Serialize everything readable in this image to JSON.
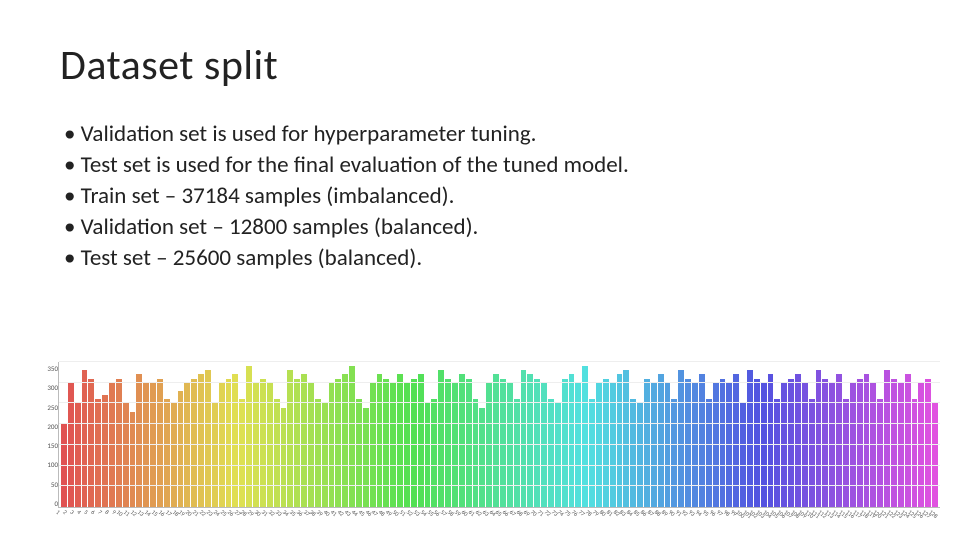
{
  "title": "Dataset split",
  "bullets": [
    "Validation set is used for hyperparameter tuning.",
    "Test set is used for the final evaluation of the tuned model.",
    "Train set – 37184 samples (imbalanced).",
    "Validation set – 12800 samples (balanced).",
    "Test set – 25600 samples (balanced)."
  ],
  "chart_data": {
    "type": "bar",
    "title": "",
    "xlabel": "",
    "ylabel": "",
    "ylim": [
      0,
      350
    ],
    "y_ticks": [
      0,
      50,
      100,
      150,
      200,
      250,
      300,
      350
    ],
    "categories": [
      1,
      2,
      3,
      4,
      5,
      6,
      7,
      8,
      9,
      10,
      11,
      12,
      13,
      14,
      15,
      16,
      17,
      18,
      19,
      20,
      21,
      22,
      23,
      24,
      25,
      26,
      27,
      28,
      29,
      30,
      31,
      32,
      33,
      34,
      35,
      36,
      37,
      38,
      39,
      40,
      41,
      42,
      43,
      44,
      45,
      46,
      47,
      48,
      49,
      50,
      51,
      52,
      53,
      54,
      55,
      56,
      57,
      58,
      59,
      60,
      61,
      62,
      63,
      64,
      65,
      66,
      67,
      68,
      69,
      70,
      71,
      72,
      73,
      74,
      75,
      76,
      77,
      78,
      79,
      80,
      81,
      82,
      83,
      84,
      85,
      86,
      87,
      88,
      89,
      90,
      91,
      92,
      93,
      94,
      95,
      96,
      97,
      98,
      99,
      100,
      101,
      102,
      103,
      104,
      105,
      106,
      107,
      108,
      109,
      110,
      111,
      112,
      113,
      114,
      115,
      116,
      117,
      118,
      119,
      120,
      121,
      122,
      123,
      124,
      125,
      126,
      127,
      128
    ],
    "values": [
      200,
      300,
      250,
      330,
      310,
      260,
      270,
      300,
      310,
      250,
      230,
      320,
      300,
      300,
      310,
      260,
      250,
      280,
      300,
      310,
      320,
      330,
      250,
      300,
      310,
      320,
      260,
      340,
      300,
      310,
      300,
      260,
      240,
      330,
      310,
      320,
      300,
      260,
      250,
      300,
      310,
      320,
      340,
      260,
      240,
      300,
      320,
      310,
      300,
      320,
      300,
      310,
      320,
      250,
      260,
      330,
      310,
      300,
      320,
      310,
      260,
      240,
      300,
      320,
      310,
      300,
      260,
      330,
      320,
      310,
      300,
      260,
      250,
      310,
      320,
      300,
      340,
      260,
      300,
      310,
      300,
      320,
      330,
      260,
      250,
      310,
      300,
      320,
      300,
      260,
      330,
      310,
      300,
      320,
      260,
      300,
      310,
      300,
      320,
      250,
      330,
      310,
      300,
      320,
      260,
      300,
      310,
      320,
      300,
      260,
      330,
      310,
      300,
      320,
      260,
      300,
      310,
      320,
      300,
      260,
      330,
      310,
      300,
      320,
      260,
      300,
      310,
      250
    ],
    "colors": "rainbow"
  }
}
